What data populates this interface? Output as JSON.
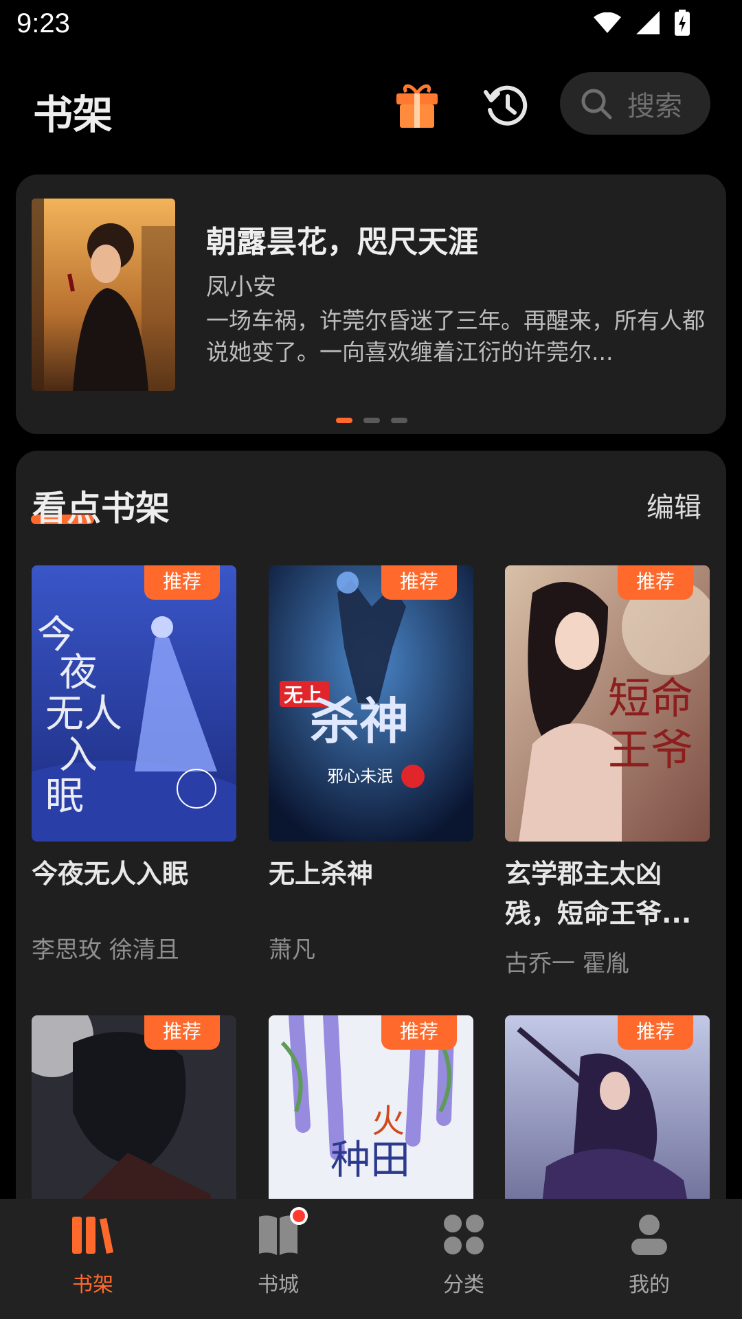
{
  "status_bar": {
    "time": "9:23"
  },
  "header": {
    "title": "书架",
    "search_placeholder": "搜索"
  },
  "banner": {
    "title": "朝露昙花，咫尺天涯",
    "author": "凤小安",
    "description": "一场车祸，许莞尔昏迷了三年。再醒来，所有人都说她变了。一向喜欢缠着江衍的许莞尔...",
    "active_page": 1,
    "page_count": 3
  },
  "shelf": {
    "title": "看点书架",
    "edit_label": "编辑",
    "badge_label": "推荐",
    "books": [
      {
        "title": "今夜无人入眠",
        "author": "李思玫 徐清且"
      },
      {
        "title": "无上杀神",
        "author": "萧凡"
      },
      {
        "title": "玄学郡主太凶残，短命王爷...",
        "author": "古乔一 霍胤"
      }
    ]
  },
  "nav": {
    "items": [
      {
        "label": "书架"
      },
      {
        "label": "书城"
      },
      {
        "label": "分类"
      },
      {
        "label": "我的"
      }
    ]
  },
  "colors": {
    "accent": "#ff6a2c",
    "background": "#000000",
    "card": "#1f1f1f",
    "nav": "#222222"
  }
}
